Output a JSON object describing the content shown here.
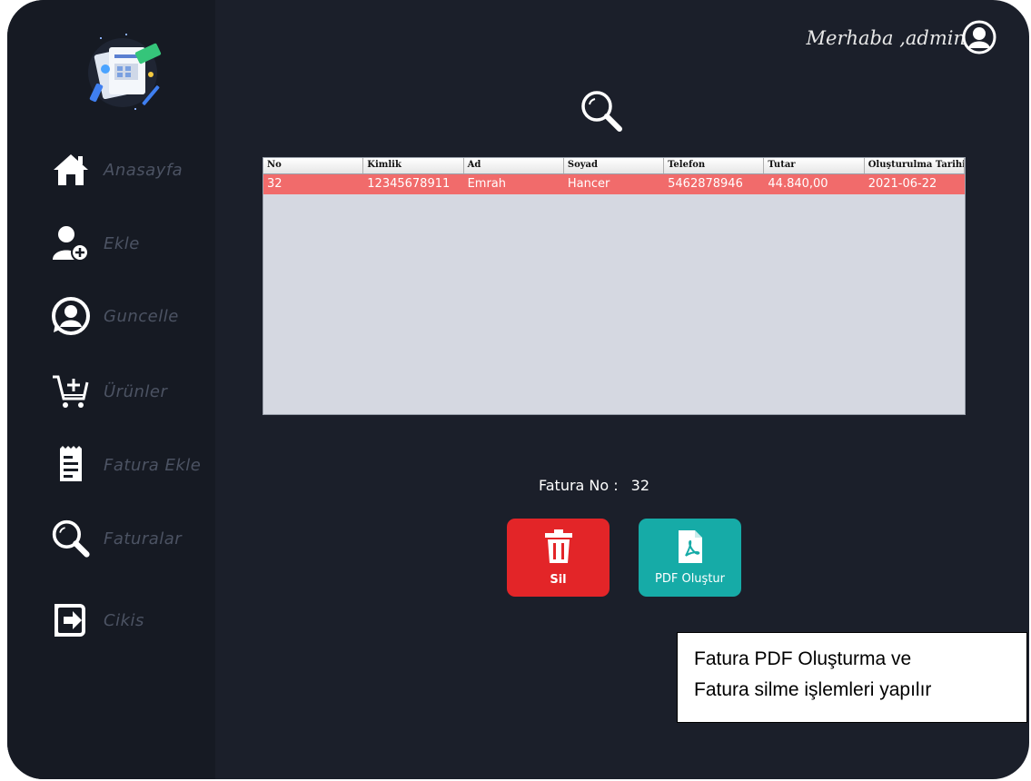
{
  "header": {
    "greeting": "Merhaba ,admin"
  },
  "sidebar": {
    "items": [
      {
        "label": "Anasayfa",
        "icon": "home-icon"
      },
      {
        "label": "Ekle",
        "icon": "add-user-icon"
      },
      {
        "label": "Guncelle",
        "icon": "user-refresh-icon"
      },
      {
        "label": "Ürünler",
        "icon": "cart-add-icon"
      },
      {
        "label": "Fatura Ekle",
        "icon": "invoice-icon"
      },
      {
        "label": "Faturalar",
        "icon": "search-icon"
      },
      {
        "label": "Cikis",
        "icon": "logout-icon"
      }
    ]
  },
  "table": {
    "columns": [
      "No",
      "Kimlik",
      "Ad",
      "Soyad",
      "Telefon",
      "Tutar",
      "Oluşturulma Tarihi"
    ],
    "rows": [
      [
        "32",
        "12345678911",
        "Emrah",
        "Hancer",
        "5462878946",
        "44.840,00",
        "2021-06-22"
      ]
    ],
    "selected_row_color": "#f16b6b"
  },
  "invoice": {
    "label": "Fatura No :",
    "value": "32"
  },
  "buttons": {
    "delete_label": "Sil",
    "pdf_label": "PDF Oluştur",
    "delete_color": "#e32528",
    "pdf_color": "#16aba7"
  },
  "note": {
    "line1": "Fatura PDF Oluşturma ve",
    "line2": "Fatura silme işlemleri yapılır"
  }
}
